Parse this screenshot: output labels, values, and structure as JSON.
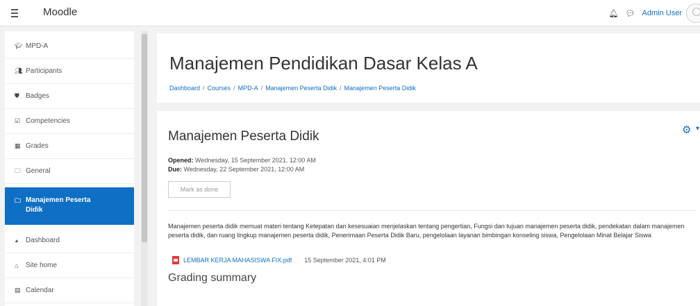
{
  "navbar": {
    "brand": "Moodle",
    "user_name": "Admin User",
    "icons": [
      "menu-icon",
      "bell-icon",
      "chat-icon"
    ]
  },
  "sidebar": {
    "items": [
      {
        "icon": "graduation-cap-icon",
        "label": "MPD-A"
      },
      {
        "icon": "users-icon",
        "label": "Participants"
      },
      {
        "icon": "shield-icon",
        "label": "Badges"
      },
      {
        "icon": "checkbox-icon",
        "label": "Competencies"
      },
      {
        "icon": "table-icon",
        "label": "Grades"
      },
      {
        "icon": "folder-icon",
        "label": "General"
      },
      {
        "icon": "folder-icon",
        "label": "Manajemen Peserta Didik",
        "active": true
      },
      {
        "icon": "dashboard-icon",
        "label": "Dashboard"
      },
      {
        "icon": "home-icon",
        "label": "Site home"
      },
      {
        "icon": "calendar-icon",
        "label": "Calendar"
      }
    ]
  },
  "header": {
    "title": "Manajemen Pendidikan Dasar Kelas A",
    "breadcrumb": [
      "Dashboard",
      "Courses",
      "MPD-A",
      "Manajemen Peserta Didik",
      "Manajemen Peserta Didik"
    ]
  },
  "activity": {
    "title": "Manajemen Peserta Didik",
    "opened_label": "Opened:",
    "opened_value": "Wednesday, 15 September 2021, 12:00 AM",
    "due_label": "Due:",
    "due_value": "Wednesday, 22 September 2021, 12:00 AM",
    "mark_done_label": "Mark as done",
    "description": "Manajemen peserta didik memuat materi tentang Ketepatan dan kesesuaian menjelaskan tentang pengertian, Fungsi dan tujuan manajemen peserta didik, pendekatan dalam manajemen peserta didik, dan ruang lingkup manajemen peserta didik, Penerimaan Peserta Didik Baru, pengelolaan layanan bimbingan konseling siswa, Pengelolaan Minat Belajar Siswa",
    "attachment_name": "LEMBAR KERJA MAHASISWA FIX.pdf",
    "attachment_date": "15 September 2021, 4:01 PM",
    "grading_title": "Grading summary"
  },
  "colors": {
    "accent": "#0f6fc5",
    "page_bg": "#f2f2f2"
  }
}
